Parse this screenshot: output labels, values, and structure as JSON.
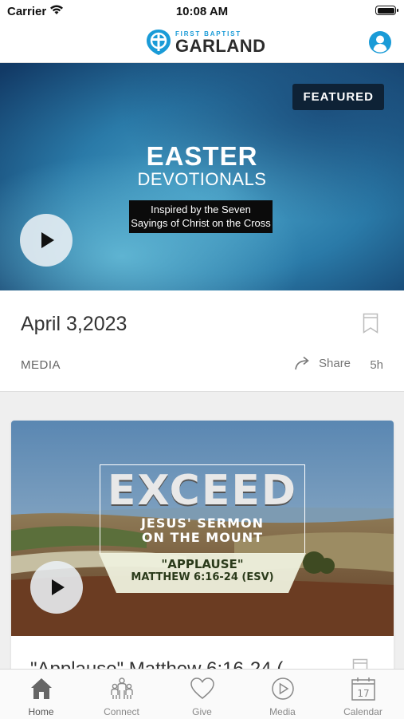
{
  "status_bar": {
    "carrier": "Carrier",
    "time": "10:08 AM"
  },
  "header": {
    "logo_small": "FIRST BAPTIST",
    "logo_big": "GARLAND"
  },
  "featured_card": {
    "badge": "FEATURED",
    "image_title": "EASTER",
    "image_subtitle": "DEVOTIONALS",
    "image_caption_line1": "Inspired by the Seven",
    "image_caption_line2": "Sayings of Christ on the Cross",
    "date": "April 3,2023",
    "category": "MEDIA",
    "share_label": "Share",
    "age": "5h"
  },
  "sermon_card": {
    "image_title": "EXCEED",
    "image_subtitle_line1": "JESUS' SERMON",
    "image_subtitle_line2": "ON THE MOUNT",
    "image_quote": "\"APPLAUSE\"",
    "image_reference": "MATTHEW 6:16-24 (ESV)",
    "title": "\"Applause\" Matthew 6:16-24 ("
  },
  "tabs": [
    {
      "label": "Home",
      "icon": "home-icon",
      "active": true
    },
    {
      "label": "Connect",
      "icon": "people-icon",
      "active": false
    },
    {
      "label": "Give",
      "icon": "heart-icon",
      "active": false
    },
    {
      "label": "Media",
      "icon": "play-circle-icon",
      "active": false
    },
    {
      "label": "Calendar",
      "icon": "calendar-icon",
      "active": false
    }
  ],
  "calendar_icon_day": "17",
  "colors": {
    "brand_blue": "#1a9bd7",
    "badge_bg": "#0e2236"
  }
}
